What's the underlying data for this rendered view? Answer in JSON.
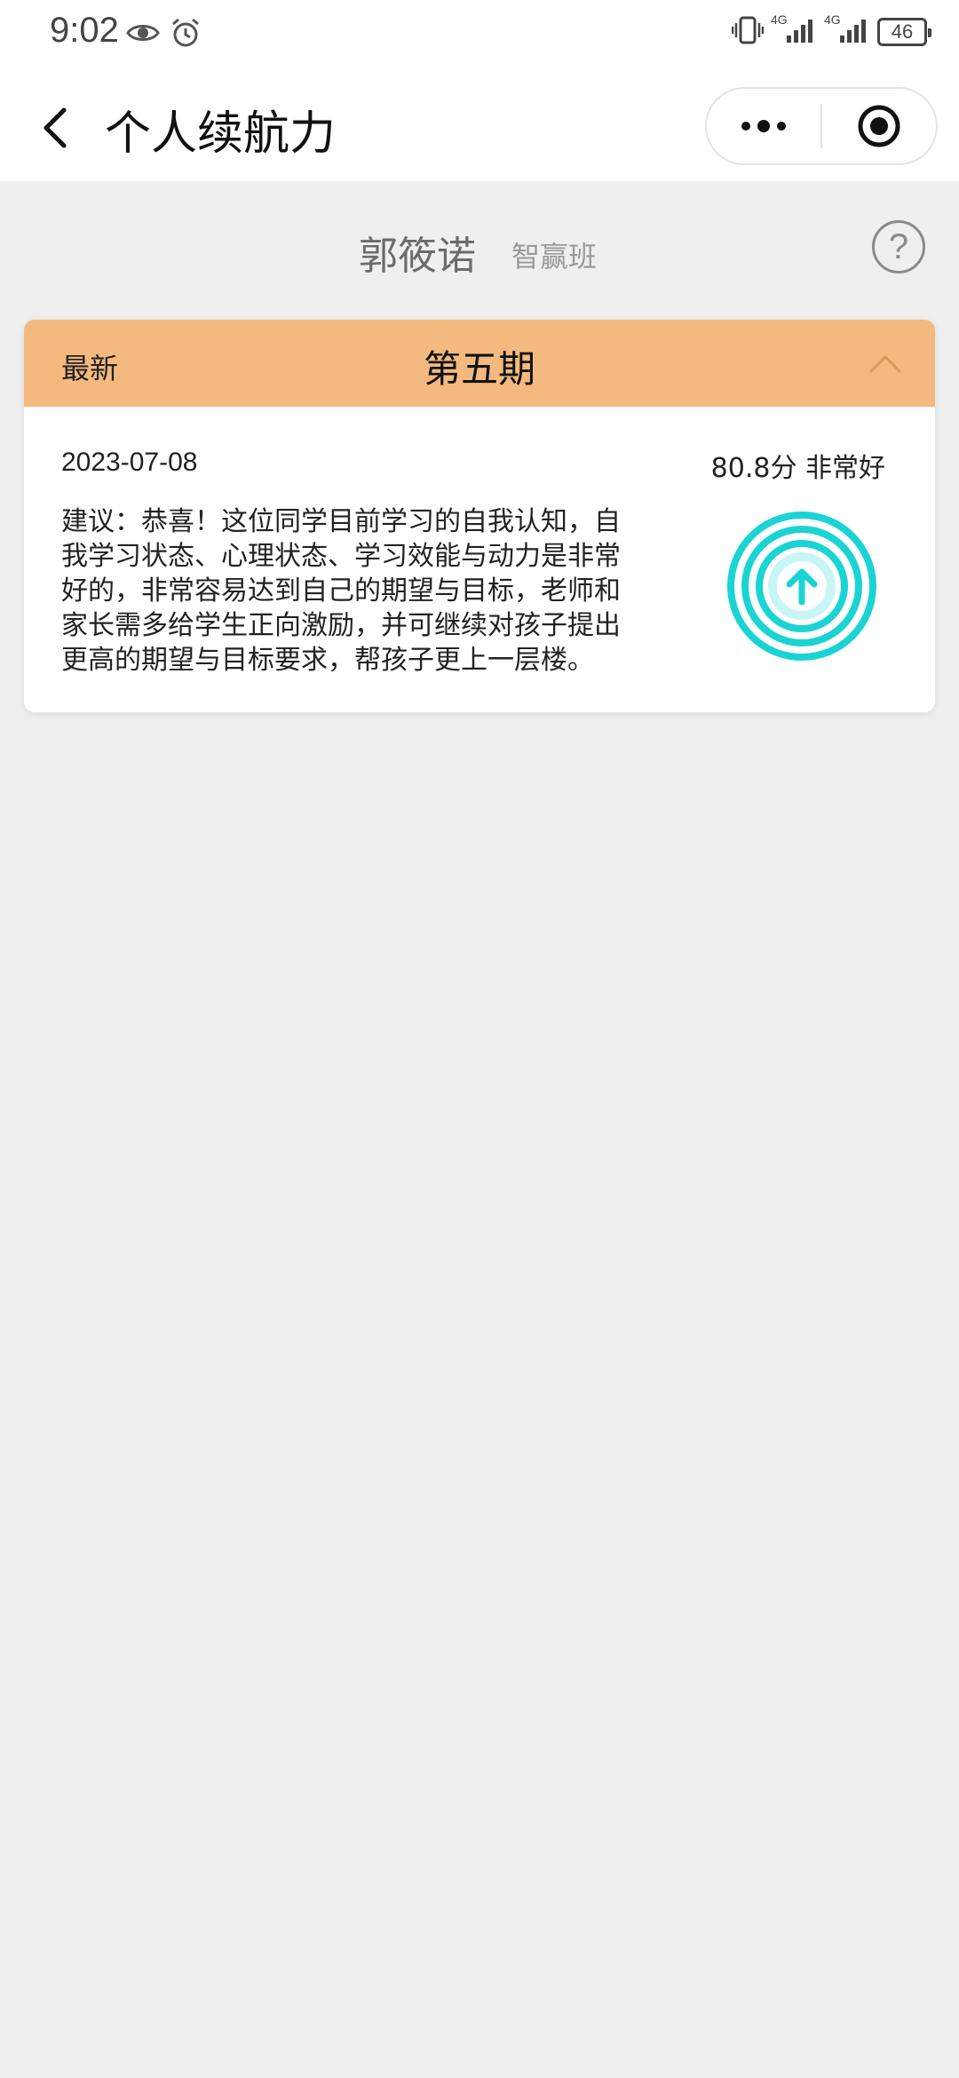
{
  "status_bar": {
    "time": "9:02",
    "battery": "46",
    "signal_label": "4G"
  },
  "nav": {
    "title": "个人续航力"
  },
  "student": {
    "name": "郭筱诺",
    "class": "智赢班",
    "help_label": "?"
  },
  "record": {
    "latest_label": "最新",
    "period": "第五期",
    "date": "2023-07-08",
    "score": "80.8分 非常好",
    "advice": "建议：恭喜！这位同学目前学习的自我认知，自我学习状态、心理状态、学习效能与动力是非常好的，非常容易达到自己的期望与目标，老师和家长需多给学生正向激励，并可继续对孩子提出更高的期望与目标要求，帮孩子更上一层楼。"
  },
  "colors": {
    "header_bg": "#f4b97f",
    "rating_teal": "#1ad4d4",
    "page_bg": "#efefef"
  },
  "icons": {
    "eye": "eye-icon",
    "alarm": "alarm-icon",
    "vibrate": "vibrate-icon",
    "back": "chevron-left-icon",
    "menu": "more-icon",
    "close": "target-close-icon",
    "collapse": "chevron-up-icon",
    "rating": "arrow-up-circle-icon"
  }
}
